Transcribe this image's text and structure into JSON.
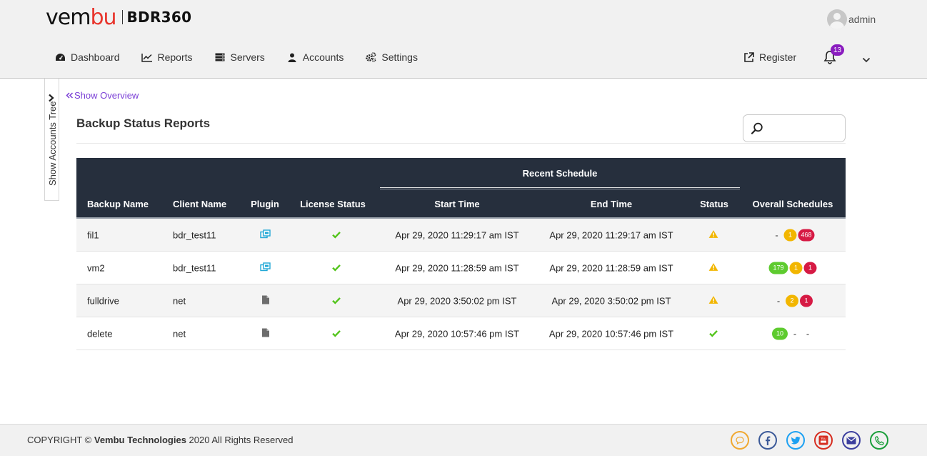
{
  "header": {
    "logo_main_a": "vem",
    "logo_main_b": "bu",
    "logo_product": "BDR360",
    "user_name": "admin",
    "notification_count": "13"
  },
  "nav": {
    "items": [
      {
        "label": "Dashboard",
        "icon": "dashboard-gauge-icon"
      },
      {
        "label": "Reports",
        "icon": "line-chart-icon"
      },
      {
        "label": "Servers",
        "icon": "server-icon"
      },
      {
        "label": "Accounts",
        "icon": "user-icon"
      },
      {
        "label": "Settings",
        "icon": "gears-icon"
      }
    ],
    "register_label": "Register"
  },
  "sidebar": {
    "toggle_label": "Show Accounts Tree"
  },
  "main": {
    "show_overview_label": "Show Overview",
    "title": "Backup Status Reports",
    "search_placeholder": ""
  },
  "table": {
    "group_header": "Recent Schedule",
    "columns": [
      "Backup Name",
      "Client Name",
      "Plugin",
      "License Status",
      "Start Time",
      "End Time",
      "Status",
      "Overall Schedules"
    ],
    "rows": [
      {
        "backup_name": "fil1",
        "client_name": "bdr_test11",
        "plugin": "vm-copies-icon",
        "license": "check",
        "start": "Apr 29, 2020 11:29:17 am IST",
        "end": "Apr 29, 2020 11:29:17 am IST",
        "status": "warning",
        "success": "-",
        "warn": "1",
        "fail": "468"
      },
      {
        "backup_name": "vm2",
        "client_name": "bdr_test11",
        "plugin": "vm-copies-icon",
        "license": "check",
        "start": "Apr 29, 2020 11:28:59 am IST",
        "end": "Apr 29, 2020 11:28:59 am IST",
        "status": "warning",
        "success": "179",
        "warn": "1",
        "fail": "1"
      },
      {
        "backup_name": "fulldrive",
        "client_name": "net",
        "plugin": "file-icon",
        "license": "check",
        "start": "Apr 29, 2020 3:50:02 pm IST",
        "end": "Apr 29, 2020 3:50:02 pm IST",
        "status": "warning",
        "success": "-",
        "warn": "2",
        "fail": "1"
      },
      {
        "backup_name": "delete",
        "client_name": "net",
        "plugin": "file-icon",
        "license": "check",
        "start": "Apr 29, 2020 10:57:46 pm IST",
        "end": "Apr 29, 2020 10:57:46 pm IST",
        "status": "success",
        "success": "10",
        "warn": "-",
        "fail": "-"
      }
    ]
  },
  "footer": {
    "copyright_prefix": "COPYRIGHT © ",
    "company": "Vembu Technologies",
    "copyright_suffix": " 2020 All Rights Reserved",
    "socials": [
      {
        "name": "chat-icon",
        "color": "#f0a830"
      },
      {
        "name": "facebook-icon",
        "color": "#3b5998"
      },
      {
        "name": "twitter-icon",
        "color": "#1da1f2"
      },
      {
        "name": "youtube-icon",
        "color": "#d62d20"
      },
      {
        "name": "email-icon",
        "color": "#3c3f9e"
      },
      {
        "name": "phone-icon",
        "color": "#1a9e3a"
      }
    ]
  },
  "colors": {
    "header_bg": "#f1f1f1",
    "table_header_bg": "#262f3d",
    "accent_purple": "#7a3ed6",
    "success_green": "#5ecb2f",
    "warning_yellow": "#f2b600",
    "fail_red": "#d61a44"
  }
}
